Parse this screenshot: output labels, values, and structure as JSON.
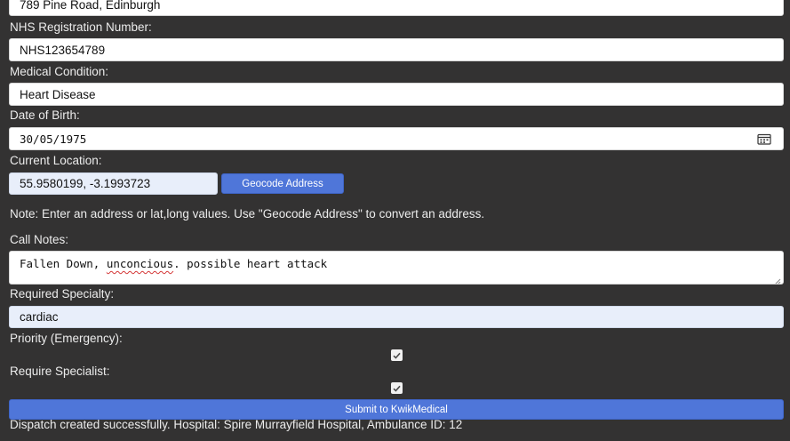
{
  "form": {
    "address_value": "789 Pine Road, Edinburgh",
    "nhs_label": "NHS Registration Number:",
    "nhs_value": "NHS123654789",
    "condition_label": "Medical Condition:",
    "condition_value": "Heart Disease",
    "dob_label": "Date of Birth:",
    "dob_value": "30/05/1975",
    "location_label": "Current Location:",
    "location_value": "55.9580199, -3.1993723",
    "geocode_button": "Geocode Address",
    "note_text": "Note: Enter an address or lat,long values. Use \"Geocode Address\" to convert an address.",
    "call_notes_label": "Call Notes:",
    "call_notes_before": "Fallen Down, ",
    "call_notes_misspelled": "unconcious",
    "call_notes_after": ". possible heart attack",
    "specialty_label": "Required Specialty:",
    "specialty_value": "cardiac",
    "priority_label": "Priority (Emergency):",
    "priority_checked": true,
    "specialist_label": "Require Specialist:",
    "specialist_checked": true,
    "submit_button": "Submit to KwikMedical",
    "status_message": "Dispatch created successfully. Hospital: Spire Murrayfield Hospital, Ambulance ID: 12"
  },
  "colors": {
    "page_background": "#333232",
    "button_blue": "#4f76d9",
    "autofill_fill": "#e8eefa"
  },
  "icons": {
    "date_picker": "calendar-icon",
    "checkbox_mark": "checkmark-icon"
  }
}
